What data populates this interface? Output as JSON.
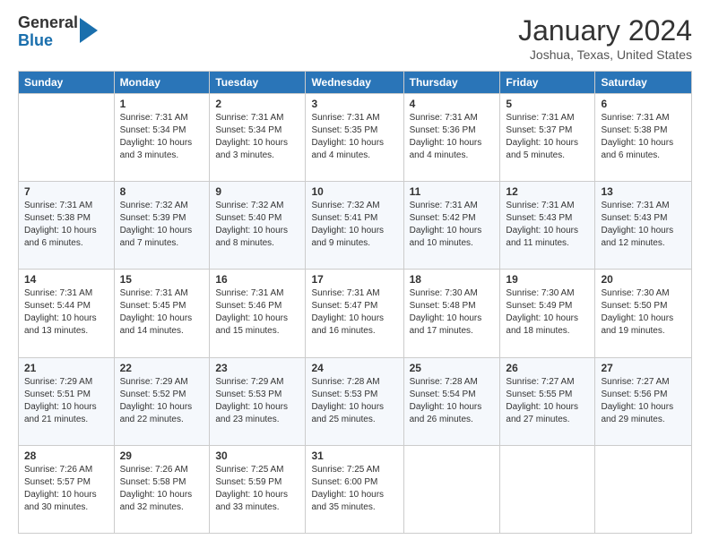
{
  "logo": {
    "general": "General",
    "blue": "Blue"
  },
  "header": {
    "month": "January 2024",
    "location": "Joshua, Texas, United States"
  },
  "days_of_week": [
    "Sunday",
    "Monday",
    "Tuesday",
    "Wednesday",
    "Thursday",
    "Friday",
    "Saturday"
  ],
  "weeks": [
    [
      {
        "day": "",
        "sunrise": "",
        "sunset": "",
        "daylight": ""
      },
      {
        "day": "1",
        "sunrise": "Sunrise: 7:31 AM",
        "sunset": "Sunset: 5:34 PM",
        "daylight": "Daylight: 10 hours and 3 minutes."
      },
      {
        "day": "2",
        "sunrise": "Sunrise: 7:31 AM",
        "sunset": "Sunset: 5:34 PM",
        "daylight": "Daylight: 10 hours and 3 minutes."
      },
      {
        "day": "3",
        "sunrise": "Sunrise: 7:31 AM",
        "sunset": "Sunset: 5:35 PM",
        "daylight": "Daylight: 10 hours and 4 minutes."
      },
      {
        "day": "4",
        "sunrise": "Sunrise: 7:31 AM",
        "sunset": "Sunset: 5:36 PM",
        "daylight": "Daylight: 10 hours and 4 minutes."
      },
      {
        "day": "5",
        "sunrise": "Sunrise: 7:31 AM",
        "sunset": "Sunset: 5:37 PM",
        "daylight": "Daylight: 10 hours and 5 minutes."
      },
      {
        "day": "6",
        "sunrise": "Sunrise: 7:31 AM",
        "sunset": "Sunset: 5:38 PM",
        "daylight": "Daylight: 10 hours and 6 minutes."
      }
    ],
    [
      {
        "day": "7",
        "sunrise": "Sunrise: 7:31 AM",
        "sunset": "Sunset: 5:38 PM",
        "daylight": "Daylight: 10 hours and 6 minutes."
      },
      {
        "day": "8",
        "sunrise": "Sunrise: 7:32 AM",
        "sunset": "Sunset: 5:39 PM",
        "daylight": "Daylight: 10 hours and 7 minutes."
      },
      {
        "day": "9",
        "sunrise": "Sunrise: 7:32 AM",
        "sunset": "Sunset: 5:40 PM",
        "daylight": "Daylight: 10 hours and 8 minutes."
      },
      {
        "day": "10",
        "sunrise": "Sunrise: 7:32 AM",
        "sunset": "Sunset: 5:41 PM",
        "daylight": "Daylight: 10 hours and 9 minutes."
      },
      {
        "day": "11",
        "sunrise": "Sunrise: 7:31 AM",
        "sunset": "Sunset: 5:42 PM",
        "daylight": "Daylight: 10 hours and 10 minutes."
      },
      {
        "day": "12",
        "sunrise": "Sunrise: 7:31 AM",
        "sunset": "Sunset: 5:43 PM",
        "daylight": "Daylight: 10 hours and 11 minutes."
      },
      {
        "day": "13",
        "sunrise": "Sunrise: 7:31 AM",
        "sunset": "Sunset: 5:43 PM",
        "daylight": "Daylight: 10 hours and 12 minutes."
      }
    ],
    [
      {
        "day": "14",
        "sunrise": "Sunrise: 7:31 AM",
        "sunset": "Sunset: 5:44 PM",
        "daylight": "Daylight: 10 hours and 13 minutes."
      },
      {
        "day": "15",
        "sunrise": "Sunrise: 7:31 AM",
        "sunset": "Sunset: 5:45 PM",
        "daylight": "Daylight: 10 hours and 14 minutes."
      },
      {
        "day": "16",
        "sunrise": "Sunrise: 7:31 AM",
        "sunset": "Sunset: 5:46 PM",
        "daylight": "Daylight: 10 hours and 15 minutes."
      },
      {
        "day": "17",
        "sunrise": "Sunrise: 7:31 AM",
        "sunset": "Sunset: 5:47 PM",
        "daylight": "Daylight: 10 hours and 16 minutes."
      },
      {
        "day": "18",
        "sunrise": "Sunrise: 7:30 AM",
        "sunset": "Sunset: 5:48 PM",
        "daylight": "Daylight: 10 hours and 17 minutes."
      },
      {
        "day": "19",
        "sunrise": "Sunrise: 7:30 AM",
        "sunset": "Sunset: 5:49 PM",
        "daylight": "Daylight: 10 hours and 18 minutes."
      },
      {
        "day": "20",
        "sunrise": "Sunrise: 7:30 AM",
        "sunset": "Sunset: 5:50 PM",
        "daylight": "Daylight: 10 hours and 19 minutes."
      }
    ],
    [
      {
        "day": "21",
        "sunrise": "Sunrise: 7:29 AM",
        "sunset": "Sunset: 5:51 PM",
        "daylight": "Daylight: 10 hours and 21 minutes."
      },
      {
        "day": "22",
        "sunrise": "Sunrise: 7:29 AM",
        "sunset": "Sunset: 5:52 PM",
        "daylight": "Daylight: 10 hours and 22 minutes."
      },
      {
        "day": "23",
        "sunrise": "Sunrise: 7:29 AM",
        "sunset": "Sunset: 5:53 PM",
        "daylight": "Daylight: 10 hours and 23 minutes."
      },
      {
        "day": "24",
        "sunrise": "Sunrise: 7:28 AM",
        "sunset": "Sunset: 5:53 PM",
        "daylight": "Daylight: 10 hours and 25 minutes."
      },
      {
        "day": "25",
        "sunrise": "Sunrise: 7:28 AM",
        "sunset": "Sunset: 5:54 PM",
        "daylight": "Daylight: 10 hours and 26 minutes."
      },
      {
        "day": "26",
        "sunrise": "Sunrise: 7:27 AM",
        "sunset": "Sunset: 5:55 PM",
        "daylight": "Daylight: 10 hours and 27 minutes."
      },
      {
        "day": "27",
        "sunrise": "Sunrise: 7:27 AM",
        "sunset": "Sunset: 5:56 PM",
        "daylight": "Daylight: 10 hours and 29 minutes."
      }
    ],
    [
      {
        "day": "28",
        "sunrise": "Sunrise: 7:26 AM",
        "sunset": "Sunset: 5:57 PM",
        "daylight": "Daylight: 10 hours and 30 minutes."
      },
      {
        "day": "29",
        "sunrise": "Sunrise: 7:26 AM",
        "sunset": "Sunset: 5:58 PM",
        "daylight": "Daylight: 10 hours and 32 minutes."
      },
      {
        "day": "30",
        "sunrise": "Sunrise: 7:25 AM",
        "sunset": "Sunset: 5:59 PM",
        "daylight": "Daylight: 10 hours and 33 minutes."
      },
      {
        "day": "31",
        "sunrise": "Sunrise: 7:25 AM",
        "sunset": "Sunset: 6:00 PM",
        "daylight": "Daylight: 10 hours and 35 minutes."
      },
      {
        "day": "",
        "sunrise": "",
        "sunset": "",
        "daylight": ""
      },
      {
        "day": "",
        "sunrise": "",
        "sunset": "",
        "daylight": ""
      },
      {
        "day": "",
        "sunrise": "",
        "sunset": "",
        "daylight": ""
      }
    ]
  ]
}
